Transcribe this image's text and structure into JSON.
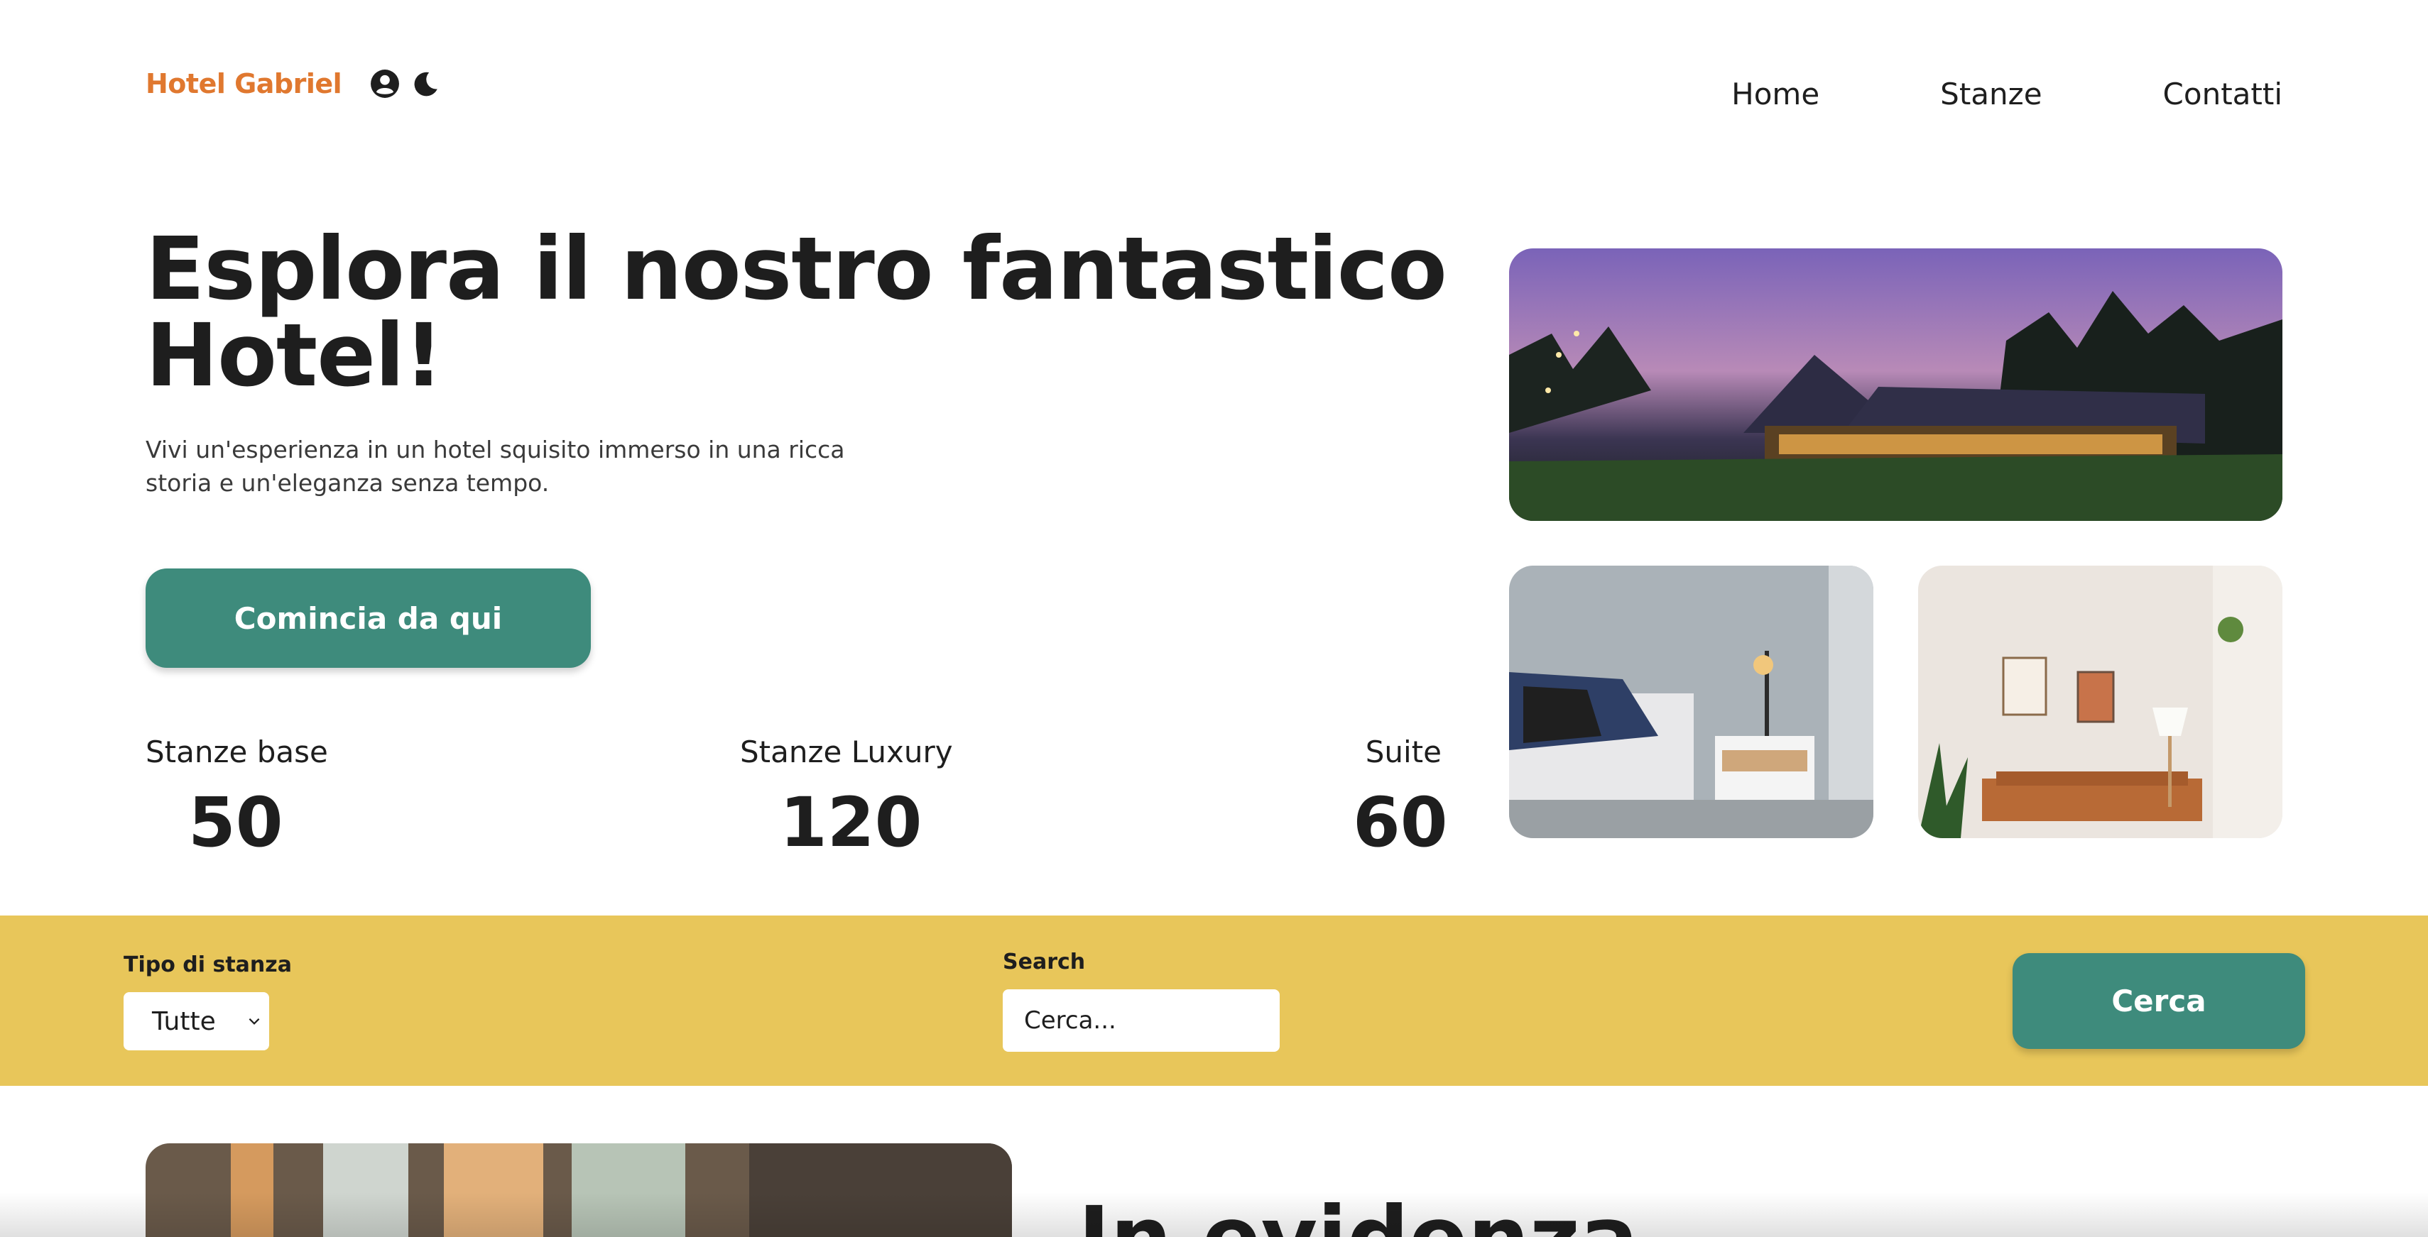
{
  "header": {
    "brand": "Hotel Gabriel",
    "icons": [
      "user-circle-icon",
      "moon-icon"
    ],
    "nav": [
      {
        "label": "Home"
      },
      {
        "label": "Stanze"
      },
      {
        "label": "Contatti"
      }
    ]
  },
  "hero": {
    "title": "Esplora il nostro fantastico Hotel!",
    "subtitle": "Vivi un'esperienza in un hotel squisito immerso in una ricca storia e un'eleganza senza tempo.",
    "cta_label": "Comincia da qui",
    "stats": [
      {
        "label": "Stanze base",
        "value": "50"
      },
      {
        "label": "Stanze Luxury",
        "value": "120"
      },
      {
        "label": "Suite",
        "value": "60"
      }
    ]
  },
  "search": {
    "room_type_label": "Tipo di stanza",
    "room_type_value": "Tutte",
    "search_label": "Search",
    "search_placeholder": "Cerca...",
    "button_label": "Cerca"
  },
  "featured": {
    "title": "In evidenza"
  },
  "colors": {
    "brand": "#e0782f",
    "accent": "#3e8b7c",
    "search_bar": "#e8c65a",
    "text": "#1e1e1e"
  }
}
